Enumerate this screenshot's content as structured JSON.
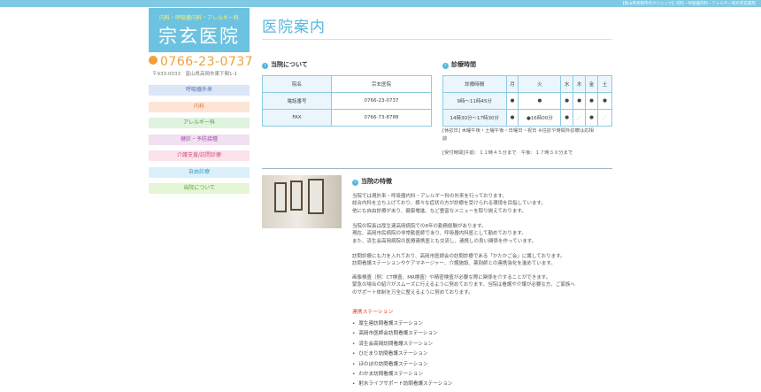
{
  "header": {
    "breadcrumb_text": "【富山県高岡市のクリニック】内科・呼吸器内科・アレルギー科の宗玄医院"
  },
  "logo": {
    "subtitle": "内科・呼吸器内科・アレルギー科",
    "name": "宗玄医院"
  },
  "contact": {
    "phone": "0766-23-0737",
    "address": "〒933-0033　富山県高岡市東下関1-1"
  },
  "sidebar": {
    "items": [
      {
        "label": "呼吸器外来"
      },
      {
        "label": "内科"
      },
      {
        "label": "アレルギー科"
      },
      {
        "label": "健診・予防接種"
      },
      {
        "label": "介護支援/訪問診療"
      },
      {
        "label": "自由診療"
      },
      {
        "label": "当院について"
      }
    ]
  },
  "main": {
    "page_title": "医院案内",
    "about": {
      "heading": "当院について",
      "rows": [
        {
          "label": "院名",
          "value": "宗玄医院"
        },
        {
          "label": "電話番号",
          "value": "0766-23-0737"
        },
        {
          "label": "FAX",
          "value": "0766-73-8788"
        }
      ]
    },
    "hours": {
      "heading": "診療時間",
      "columns": [
        "診療時間",
        "月",
        "火",
        "水",
        "木",
        "金",
        "土"
      ],
      "rows": [
        {
          "time": "9時〜11時45分",
          "cells": [
            "●",
            "●",
            "●",
            "●",
            "●",
            "●"
          ]
        },
        {
          "time": "14時30分〜17時30分",
          "cells": [
            "●",
            "●16時00分",
            "●",
            "／",
            "●",
            "／"
          ]
        }
      ],
      "note1": "[休診日] 木曜午後・土曜午後・日曜日・祝日 ※往診や時間外診療は応相",
      "note1b": "談",
      "note2": "[受付時間]午前：１１時４５分まで　午後：１７時３０分まで"
    },
    "features": {
      "heading": "当院の特徴",
      "paragraphs": [
        [
          "当院では現外来・呼吸器内科・アレルギー科の外来を行っております。",
          "総合内科を立ち上げており、様々な症状の方が診療を受けられる環境を目指しています。",
          "他にも自由診療があり、健康増進、など豊富なメニューを取り揃えております。"
        ],
        [
          "当院の院長は厚生連高岡病院での8年の勤務経験があります。",
          "現在、高岡市民病院の非常勤医師であり、呼吸器内科医として勤めております。",
          "また、済生会高岡病院の医療連携医とも交流し、連携しの良い関係を作っています。"
        ],
        [
          "訪問診療にも力を入れており、高岡市医師会の訪問診療である「かたかご会」に属しております。",
          "訪問看護ステーションやケアマネージャー、介護施設、薬剤師との連携強化を進めています。"
        ],
        [
          "画像検査（例：CT検査、MR検査）や精密検査が必要な際に関係を介することができます。",
          "緊急の場合の紹介がスムーズに行えるように努めております。当院は看護や介護が必要な方、ご家族へ",
          "のサポート体制を万全に整えるように努めております。"
        ]
      ],
      "partners_heading": "連携ステーション",
      "partners": [
        "厚生連訪問看護ステーション",
        "高岡市医師会訪問看護ステーション",
        "済生会高岡訪問看護ステーション",
        "ひだまり訪問看護ステーション",
        "ほのぼの訪問看護ステーション",
        "わかま訪問看護ステーション",
        "射水ライフサポート訪問看護ステーション"
      ]
    }
  }
}
